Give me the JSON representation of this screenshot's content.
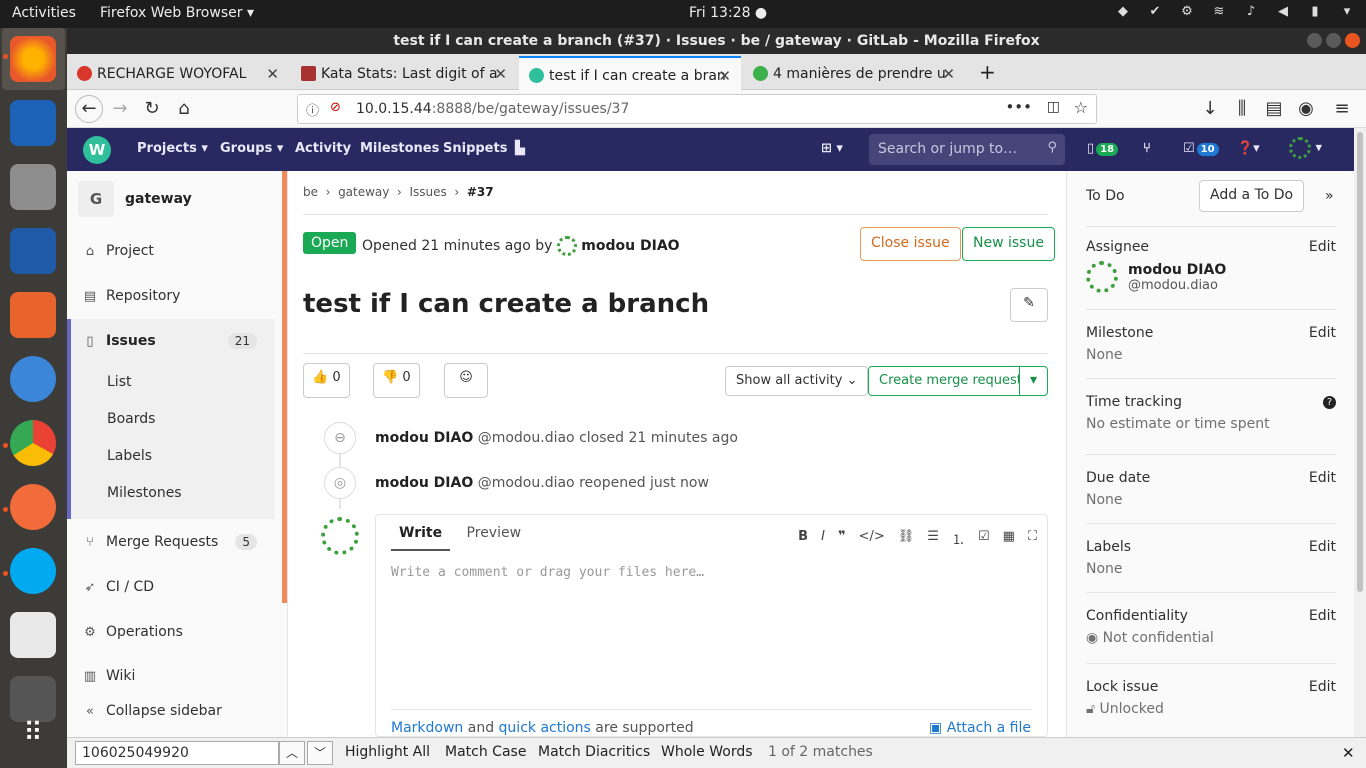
{
  "os": {
    "activities": "Activities",
    "app_menu": "Firefox Web Browser ▾",
    "clock": "Fri 13:28 ●"
  },
  "window": {
    "title": "test if I can create a branch (#37) · Issues · be / gateway · GitLab - Mozilla Firefox"
  },
  "tabs": [
    {
      "label": "RECHARGE WOYOFAL",
      "color": "#d9362b"
    },
    {
      "label": "Kata Stats: Last digit of a",
      "color": "#a83232"
    },
    {
      "label": "test if I can create a bran",
      "color": "#2fbf9b"
    },
    {
      "label": "4 manières de prendre u",
      "color": "#3bb04a"
    }
  ],
  "url": {
    "host": "10.0.15.44",
    "rest": ":8888/be/gateway/issues/37"
  },
  "gitlab_nav": {
    "logo_letter": "W",
    "projects": "Projects ▾",
    "groups": "Groups ▾",
    "activity": "Activity",
    "milestones": "Milestones",
    "snippets": "Snippets",
    "search_placeholder": "Search or jump to…",
    "issues_count": "18",
    "todo_count": "10"
  },
  "sidebar": {
    "project_letter": "G",
    "project_name": "gateway",
    "project": "Project",
    "repository": "Repository",
    "issues": "Issues",
    "issues_count": "21",
    "sub": [
      "List",
      "Boards",
      "Labels",
      "Milestones"
    ],
    "merge_requests": "Merge Requests",
    "mr_count": "5",
    "cicd": "CI / CD",
    "operations": "Operations",
    "wiki": "Wiki",
    "collapse": "Collapse sidebar"
  },
  "issue": {
    "breadcrumb": [
      "be",
      "gateway",
      "Issues",
      "#37"
    ],
    "status": "Open",
    "opened_text": "Opened 21 minutes ago by",
    "author": "modou DIAO",
    "close_button": "Close issue",
    "new_button": "New issue",
    "title": "test if I can create a branch",
    "thumbs_up": "0",
    "thumbs_down": "0",
    "activity_filter": "Show all activity ⌄",
    "create_mr": "Create merge request",
    "events": [
      {
        "author": "modou DIAO",
        "handle": "@modou.diao",
        "action": "closed 21 minutes ago"
      },
      {
        "author": "modou DIAO",
        "handle": "@modou.diao",
        "action": "reopened just now"
      }
    ],
    "comment": {
      "write_tab": "Write",
      "preview_tab": "Preview",
      "placeholder": "Write a comment or drag your files here…",
      "footer_markdown": "Markdown",
      "footer_and": "and",
      "footer_quick": "quick actions",
      "footer_supported": "are supported",
      "attach": "Attach a file"
    }
  },
  "right_sidebar": {
    "todo_label": "To Do",
    "add_todo": "Add a To Do",
    "assignee_label": "Assignee",
    "assignee_name": "modou DIAO",
    "assignee_handle": "@modou.diao",
    "edit": "Edit",
    "milestone_label": "Milestone",
    "milestone_value": "None",
    "time_label": "Time tracking",
    "time_value": "No estimate or time spent",
    "due_label": "Due date",
    "due_value": "None",
    "labels_label": "Labels",
    "labels_value": "None",
    "conf_label": "Confidentiality",
    "conf_value": "Not confidential",
    "lock_label": "Lock issue",
    "lock_value": "Unlocked"
  },
  "findbar": {
    "query": "106025049920",
    "highlight": "Highlight All",
    "match_case": "Match Case",
    "diacritics": "Match Diacritics",
    "whole_words": "Whole Words",
    "result": "1 of 2 matches"
  }
}
